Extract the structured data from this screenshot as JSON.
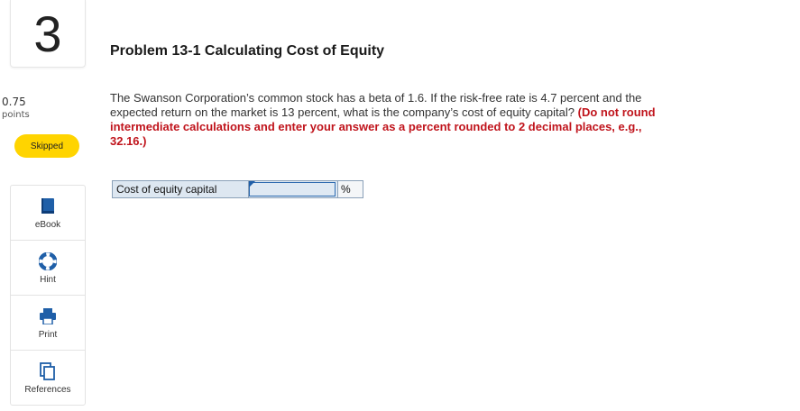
{
  "question": {
    "number": "3",
    "title": "Problem 13-1 Calculating Cost of Equity"
  },
  "score": {
    "value": "0.75",
    "label": "points",
    "status": "Skipped"
  },
  "tools": [
    {
      "label": "eBook",
      "icon": "ebook-icon"
    },
    {
      "label": "Hint",
      "icon": "lifebuoy-icon"
    },
    {
      "label": "Print",
      "icon": "printer-icon"
    },
    {
      "label": "References",
      "icon": "documents-icon"
    }
  ],
  "problem": {
    "text": "The Swanson Corporation’s common stock has a beta of 1.6. If the risk-free rate is 4.7 percent and the expected return on the market is 13 percent, what is the company’s cost of equity capital? ",
    "instruction": "(Do not round intermediate calculations and enter your answer as a percent rounded to 2 decimal places, e.g., 32.16.)"
  },
  "answer": {
    "label": "Cost of equity capital",
    "value": "",
    "unit": "%"
  },
  "colors": {
    "accent": "#1f5fa8",
    "skipped_badge": "#ffd400",
    "instruction_red": "#c0141c"
  }
}
